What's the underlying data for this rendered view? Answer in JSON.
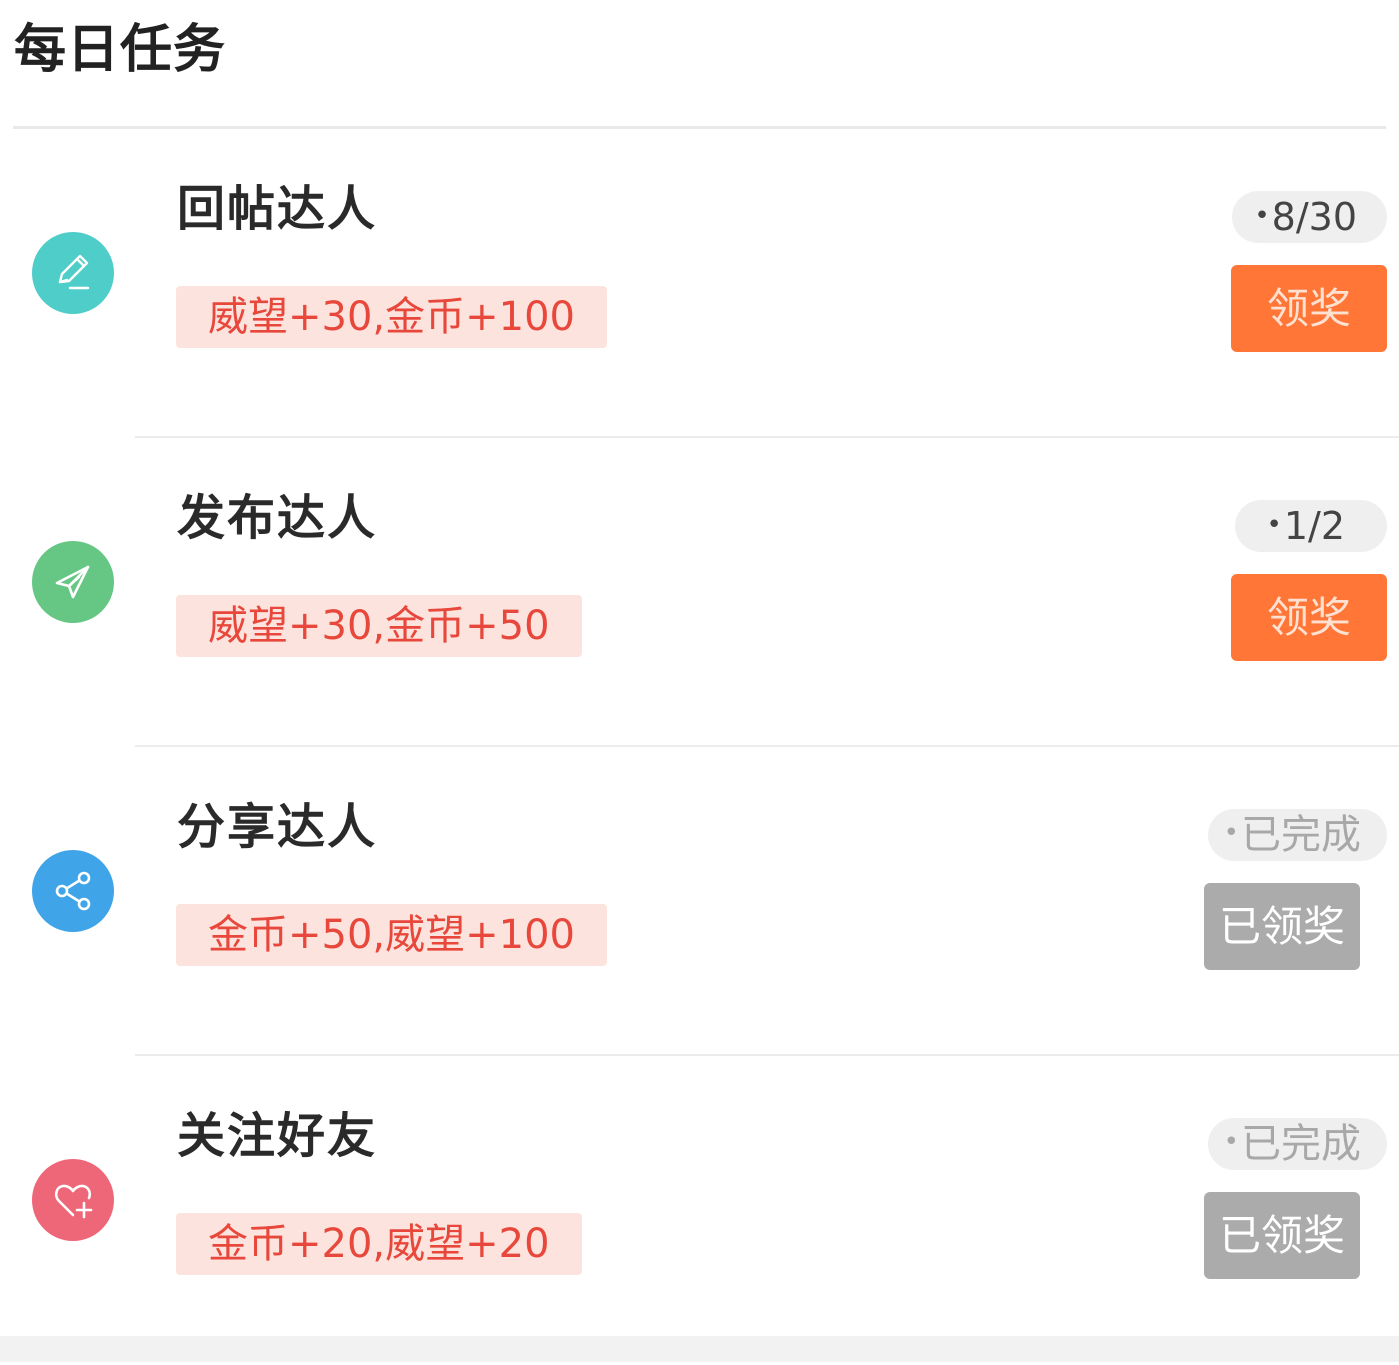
{
  "page": {
    "title": "每日任务"
  },
  "tasks": [
    {
      "name": "回帖达人",
      "reward": "威望+30,金币+100",
      "progress": "8/30",
      "button": "领奖",
      "status": "pending",
      "icon": "pencil-icon",
      "icon_color": "#4fcdc8"
    },
    {
      "name": "发布达人",
      "reward": "威望+30,金币+50",
      "progress": "1/2",
      "button": "领奖",
      "status": "pending",
      "icon": "paper-plane-icon",
      "icon_color": "#66c784"
    },
    {
      "name": "分享达人",
      "reward": "金币+50,威望+100",
      "progress": "已完成",
      "button": "已领奖",
      "status": "claimed",
      "icon": "share-icon",
      "icon_color": "#40a4e8"
    },
    {
      "name": "关注好友",
      "reward": "金币+20,威望+20",
      "progress": "已完成",
      "button": "已领奖",
      "status": "claimed",
      "icon": "heart-plus-icon",
      "icon_color": "#ee6778"
    }
  ],
  "colors": {
    "claim_button": "#ff7637",
    "claimed_button": "#ababab",
    "reward_background": "#fde3dd",
    "reward_text": "#e8483c"
  }
}
